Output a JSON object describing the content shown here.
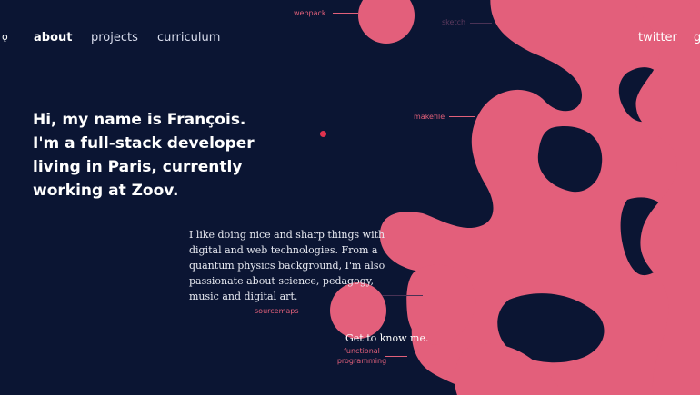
{
  "nav": {
    "logo_glyph": "ǫ",
    "about": "about",
    "projects": "projects",
    "curriculum": "curriculum",
    "twitter": "twitter",
    "github": "g"
  },
  "hero": {
    "headline": "Hi, my name is François. I'm a full-stack developer living in Paris, currently working at Zoov.",
    "bio": "I like doing nice and sharp things with digital and web technologies. From a quantum physics background, I'm also passionate about science, pedagogy, music and digital art.",
    "cta": "Get to know me."
  },
  "tags": {
    "webpack": "webpack",
    "sketch": "sketch",
    "makefile": "makefile",
    "sourcemaps": "sourcemaps",
    "functional_programming": "functional\nprogramming"
  },
  "colors": {
    "background": "#0b1533",
    "blob": "#e35f7b",
    "accent_dot": "#e0324e",
    "tag_text": "#e2607a"
  }
}
